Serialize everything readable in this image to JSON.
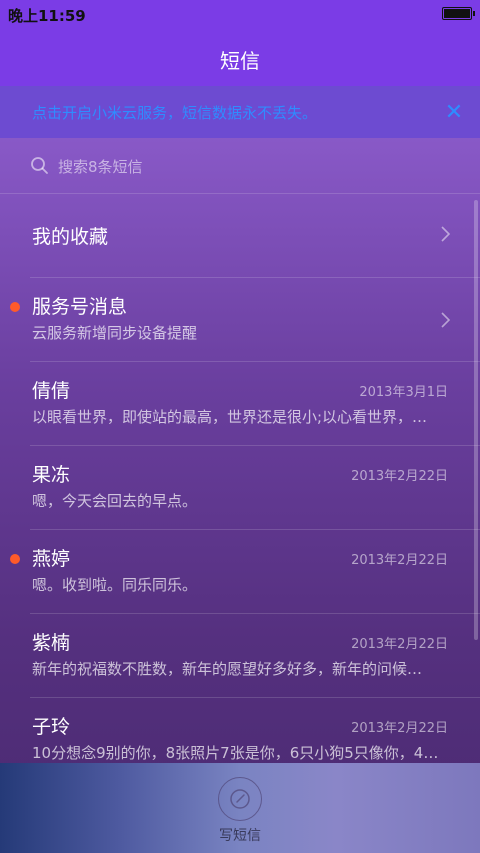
{
  "status_bar": {
    "time": "晚上11:59",
    "battery_level": 1.0
  },
  "header": {
    "title": "短信"
  },
  "cloud_banner": {
    "text": "点击开启小米云服务，短信数据永不丢失。",
    "close_icon": "close-icon"
  },
  "search": {
    "placeholder": "搜索8条短信"
  },
  "list": [
    {
      "title": "我的收藏",
      "subtitle": "",
      "date": "",
      "unread": false,
      "chevron": true
    },
    {
      "title": "服务号消息",
      "subtitle": "云服务新增同步设备提醒",
      "date": "",
      "unread": true,
      "chevron": true
    },
    {
      "title": "倩倩",
      "subtitle": "以眼看世界，即使站的最高，世界还是很小;以心看世界，…",
      "date": "2013年3月1日",
      "unread": false,
      "chevron": false
    },
    {
      "title": "果冻",
      "subtitle": "嗯，今天会回去的早点。",
      "date": "2013年2月22日",
      "unread": false,
      "chevron": false
    },
    {
      "title": "燕婷",
      "subtitle": "嗯。收到啦。同乐同乐。",
      "date": "2013年2月22日",
      "unread": true,
      "chevron": false
    },
    {
      "title": "紫楠",
      "subtitle": "新年的祝福数不胜数，新年的愿望好多好多，新年的问候…",
      "date": "2013年2月22日",
      "unread": false,
      "chevron": false
    },
    {
      "title": "子玲",
      "subtitle": "10分想念9别的你，8张照片7张是你，6只小狗5只像你，4…",
      "date": "2013年2月22日",
      "unread": false,
      "chevron": false
    }
  ],
  "bottom": {
    "compose_label": "写短信"
  },
  "colors": {
    "accent": "#7b3ce6",
    "link": "#2f8cff",
    "unread": "#ff5a2a"
  }
}
